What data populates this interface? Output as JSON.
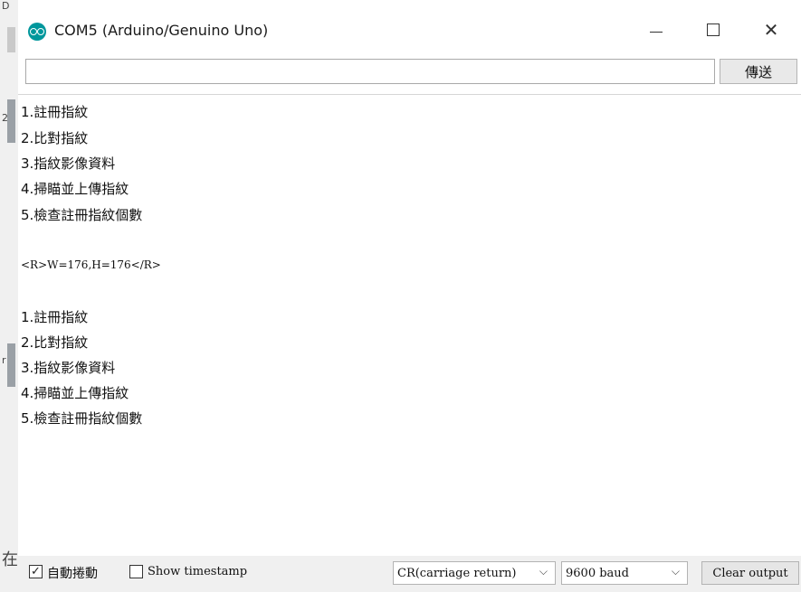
{
  "window": {
    "title": "COM5 (Arduino/Genuino Uno)",
    "app_icon": "arduino-icon",
    "controls": {
      "minimize": "minimize-icon",
      "maximize": "maximize-icon",
      "close": "close-icon"
    }
  },
  "send_bar": {
    "input_value": "",
    "send_label": "傳送"
  },
  "output": {
    "lines": [
      "1.註冊指紋",
      "2.比對指紋",
      "3.指紋影像資料",
      "4.掃瞄並上傳指紋",
      "5.檢查註冊指紋個數",
      "<R>W=176,H=176</R>",
      "1.註冊指紋",
      "2.比對指紋",
      "3.指紋影像資料",
      "4.掃瞄並上傳指紋",
      "5.檢查註冊指紋個數"
    ]
  },
  "bottom_bar": {
    "autoscroll_label": "自動捲動",
    "autoscroll_checked": true,
    "timestamp_label": "Show timestamp",
    "timestamp_checked": false,
    "line_ending_value": "CR(carriage return)",
    "baud_value": "9600 baud",
    "clear_label": "Clear output"
  },
  "background_window": {
    "marks": [
      "D",
      "2",
      "r",
      "在"
    ]
  }
}
